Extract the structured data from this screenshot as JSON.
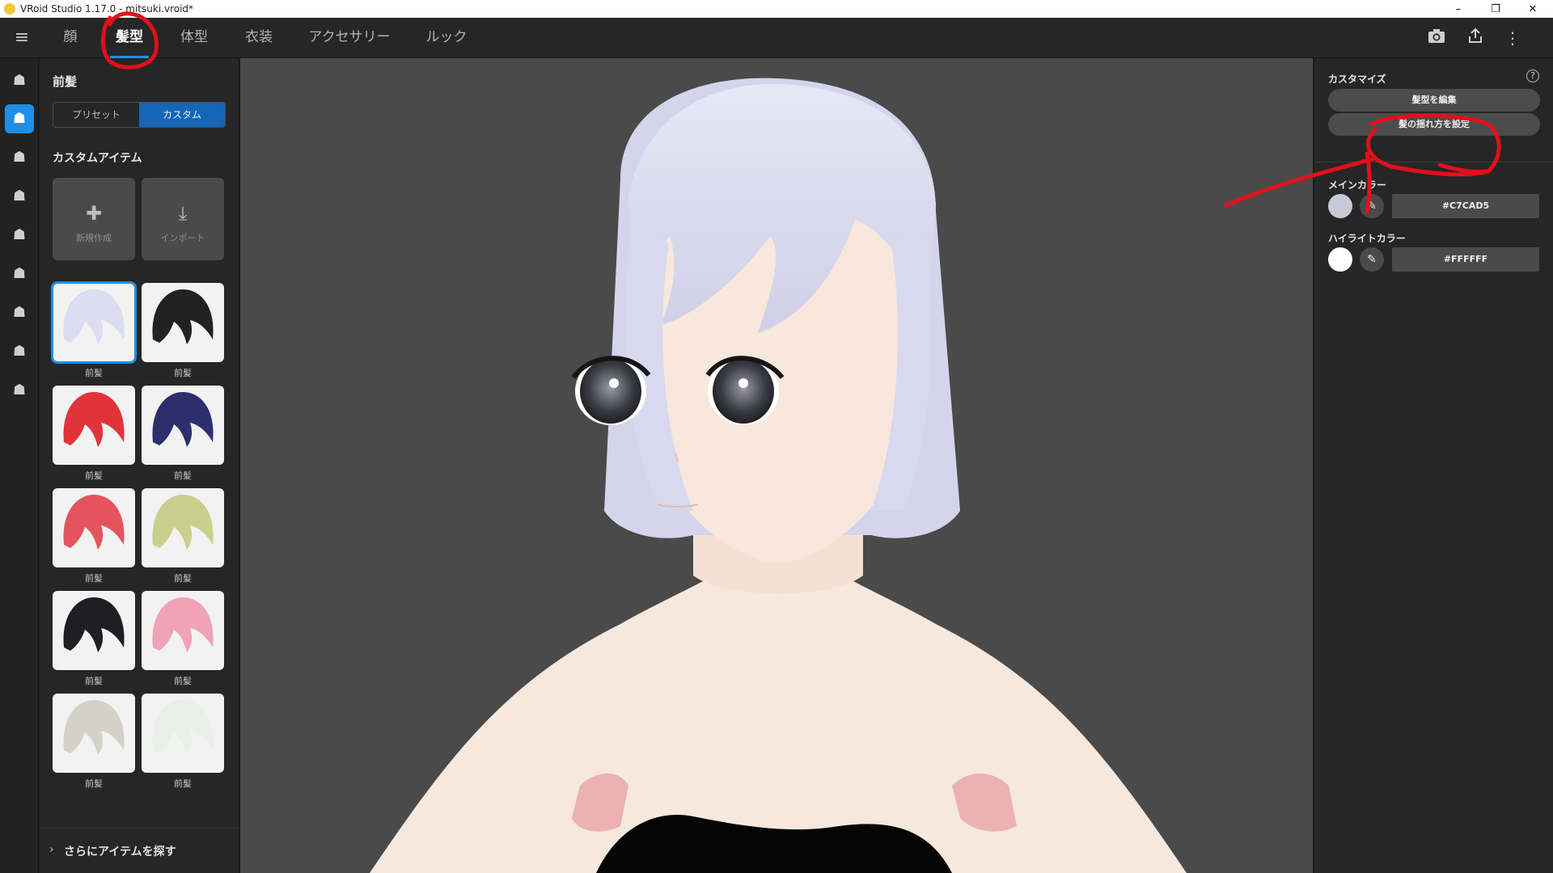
{
  "window": {
    "title": "VRoid Studio 1.17.0 - mitsuki.vroid*",
    "controls": [
      "–",
      "❐",
      "✕"
    ]
  },
  "top_tabs": [
    {
      "label": "顔"
    },
    {
      "label": "髪型"
    },
    {
      "label": "体型"
    },
    {
      "label": "衣装"
    },
    {
      "label": "アクセサリー"
    },
    {
      "label": "ルック"
    }
  ],
  "top_icons": [
    "camera-icon",
    "export-icon",
    "more-vertical-icon"
  ],
  "side_icons": [
    "hair-base-icon",
    "front-hair-icon",
    "back-hair-icon",
    "side-hair-icon",
    "ahoge-icon",
    "ponytail-icon",
    "braid-icon",
    "extra-hair-icon",
    "hair-option-icon"
  ],
  "left_panel": {
    "title": "前髪",
    "segments": [
      "プリセット",
      "カスタム"
    ],
    "section_title": "カスタムアイテム",
    "new_label": "新規作成",
    "import_label": "インポート",
    "items": [
      {
        "label": "前髪",
        "color": "#dcdcf2"
      },
      {
        "label": "前髪",
        "color": "#222222"
      },
      {
        "label": "前髪",
        "color": "#e0343a"
      },
      {
        "label": "前髪",
        "color": "#2c2f6b"
      },
      {
        "label": "前髪",
        "color": "#e4545d"
      },
      {
        "label": "前髪",
        "color": "#c9d08e"
      },
      {
        "label": "前髪",
        "color": "#1e1e24"
      },
      {
        "label": "前髪",
        "color": "#f0a3b6"
      },
      {
        "label": "前髪",
        "color": "#d3d1c8"
      },
      {
        "label": "前髪",
        "color": "#e8f0e8"
      }
    ],
    "footer": "さらにアイテムを探す"
  },
  "right_panel": {
    "title": "カスタマイズ",
    "edit_hair_button": "髪型を編集",
    "sway_button": "髪の揺れ方を設定",
    "main_color_label": "メインカラー",
    "main_color_hex": "#C7CAD5",
    "highlight_color_label": "ハイライトカラー",
    "highlight_color_hex": "#FFFFFF"
  },
  "colors": {
    "accent": "#1e8ee6",
    "annotation": "#e0101c",
    "hair": "#d6d6ee",
    "skin": "#f6e6da",
    "viewport_bg": "#4a4a4a"
  }
}
